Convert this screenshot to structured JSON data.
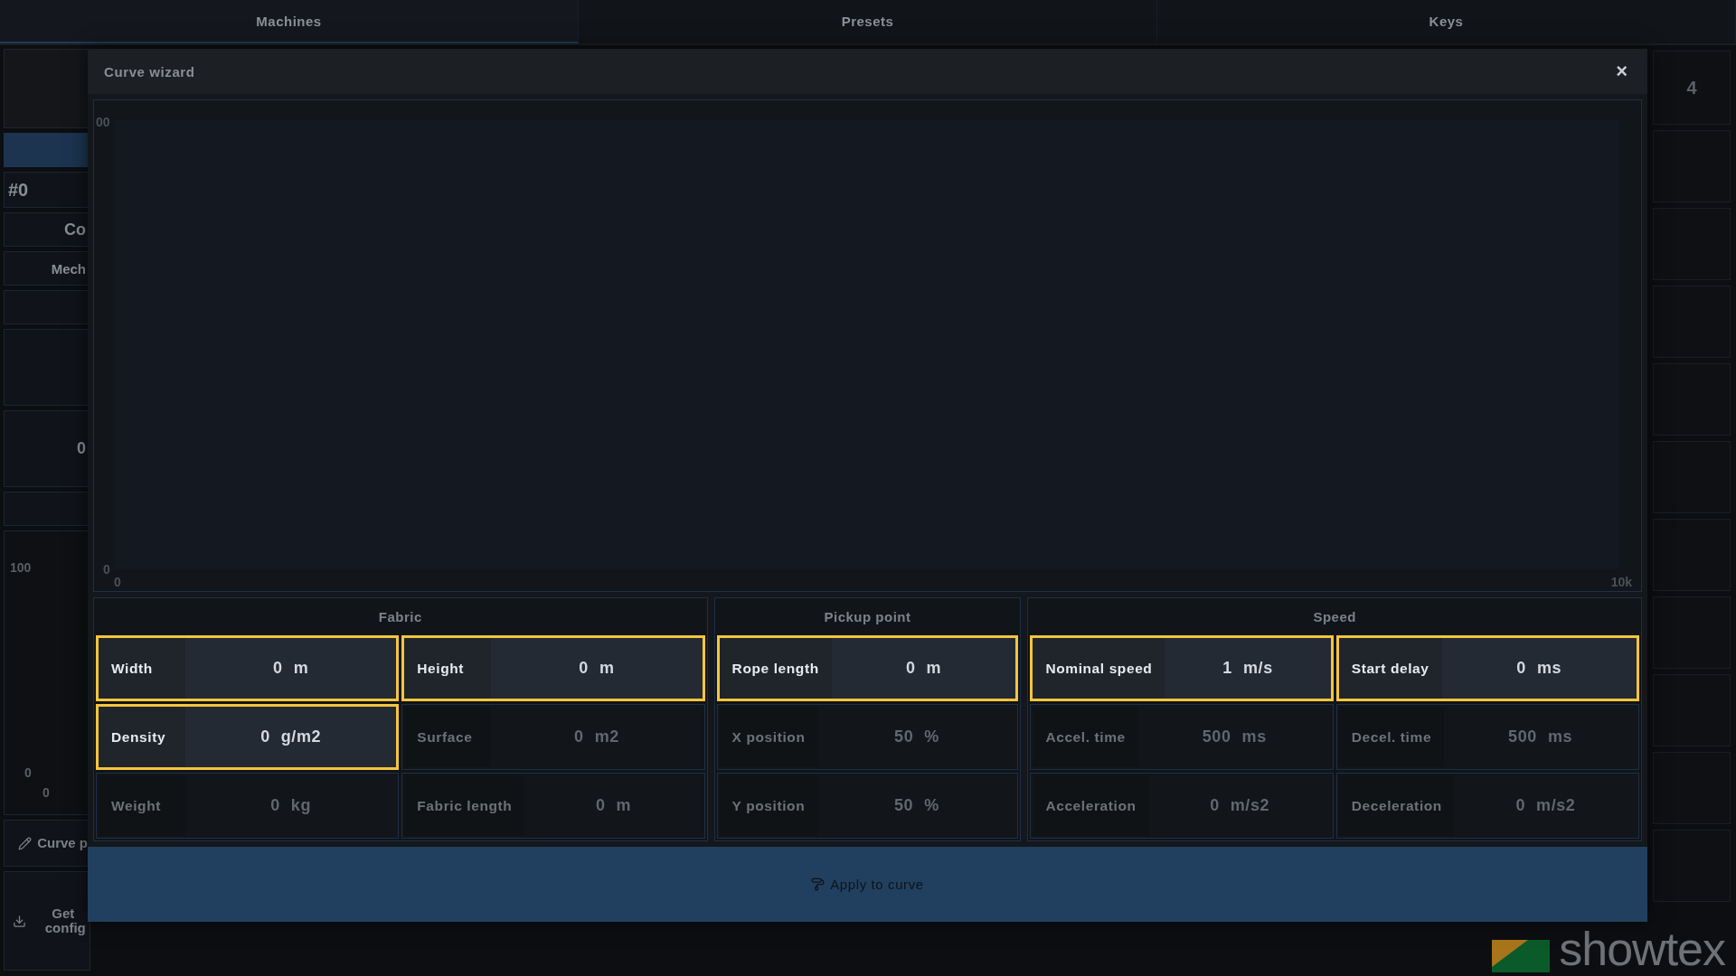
{
  "tabs": [
    {
      "label": "Machines",
      "selected": true
    },
    {
      "label": "Presets",
      "selected": false
    },
    {
      "label": "Keys",
      "selected": false
    }
  ],
  "sidebar": {
    "machine_id": "#0",
    "name": "Co",
    "type": "Mech",
    "partial_glyph": "0",
    "chart_labels": [
      "100",
      "0",
      "0"
    ],
    "curve_button": "Curve p",
    "get_config_button": "Get config"
  },
  "right_column": {
    "header": "4"
  },
  "logo": {
    "text": "showtex"
  },
  "modal": {
    "title": "Curve wizard",
    "close": "×",
    "chart": {
      "y_max": "00",
      "y_min": "0",
      "x_min": "0",
      "x_max": "10k"
    },
    "groups": [
      {
        "title": "Fabric",
        "fields": [
          {
            "label": "Width",
            "value": "0",
            "unit": "m",
            "editable": true
          },
          {
            "label": "Height",
            "value": "0",
            "unit": "m",
            "editable": true
          },
          {
            "label": "Density",
            "value": "0",
            "unit": "g/m2",
            "editable": true
          },
          {
            "label": "Surface",
            "value": "0",
            "unit": "m2",
            "editable": false
          },
          {
            "label": "Weight",
            "value": "0",
            "unit": "kg",
            "editable": false
          },
          {
            "label": "Fabric length",
            "value": "0",
            "unit": "m",
            "editable": false
          }
        ]
      },
      {
        "title": "Pickup point",
        "fields": [
          {
            "label": "Rope length",
            "value": "0",
            "unit": "m",
            "editable": true
          },
          {
            "label": "X position",
            "value": "50",
            "unit": "%",
            "editable": false
          },
          {
            "label": "Y position",
            "value": "50",
            "unit": "%",
            "editable": false
          }
        ]
      },
      {
        "title": "Speed",
        "fields": [
          {
            "label": "Nominal speed",
            "value": "1",
            "unit": "m/s",
            "editable": true
          },
          {
            "label": "Start delay",
            "value": "0",
            "unit": "ms",
            "editable": true
          },
          {
            "label": "Accel. time",
            "value": "500",
            "unit": "ms",
            "editable": false
          },
          {
            "label": "Decel. time",
            "value": "500",
            "unit": "ms",
            "editable": false
          },
          {
            "label": "Acceleration",
            "value": "0",
            "unit": "m/s2",
            "editable": false
          },
          {
            "label": "Deceleration",
            "value": "0",
            "unit": "m/s2",
            "editable": false
          }
        ]
      }
    ],
    "apply_button": "Apply to curve"
  }
}
